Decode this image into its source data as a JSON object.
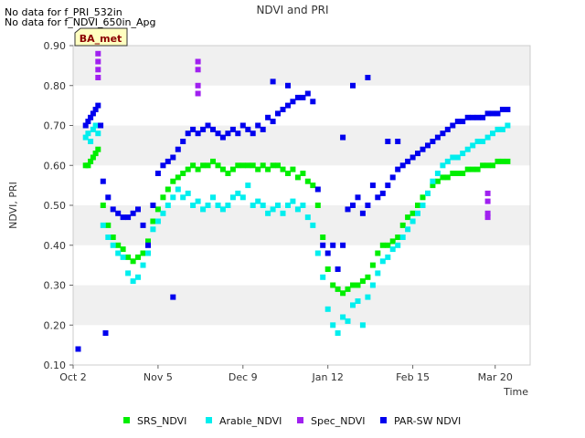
{
  "notes": [
    "No data for f_PRI_532in",
    "No data for f_NDVI_650in_Apg"
  ],
  "badge": "BA_met",
  "chart_data": {
    "type": "scatter",
    "title": "NDVI and PRI",
    "xlabel": "Time",
    "ylabel": "NDVI, PRI",
    "x_ticks": [
      "Oct 2",
      "Nov 5",
      "Dec 9",
      "Jan 12",
      "Feb 15",
      "Mar 20"
    ],
    "x_tick_day": [
      0,
      34,
      68,
      102,
      136,
      169
    ],
    "xlim": [
      0,
      183
    ],
    "ylim": [
      0.1,
      0.9
    ],
    "y_ticks": [
      0.1,
      0.2,
      0.3,
      0.4,
      0.5,
      0.6,
      0.7,
      0.8,
      0.9
    ],
    "grid": "horizontal bands",
    "legend_position": "bottom",
    "series": [
      {
        "name": "SRS_NDVI",
        "color": "#00ee00",
        "points": [
          [
            5,
            0.6
          ],
          [
            6,
            0.6
          ],
          [
            7,
            0.61
          ],
          [
            8,
            0.62
          ],
          [
            9,
            0.63
          ],
          [
            10,
            0.64
          ],
          [
            12,
            0.5
          ],
          [
            14,
            0.45
          ],
          [
            16,
            0.42
          ],
          [
            18,
            0.4
          ],
          [
            20,
            0.39
          ],
          [
            22,
            0.37
          ],
          [
            24,
            0.36
          ],
          [
            26,
            0.37
          ],
          [
            28,
            0.38
          ],
          [
            30,
            0.41
          ],
          [
            32,
            0.46
          ],
          [
            34,
            0.49
          ],
          [
            36,
            0.52
          ],
          [
            38,
            0.54
          ],
          [
            40,
            0.56
          ],
          [
            42,
            0.57
          ],
          [
            44,
            0.58
          ],
          [
            46,
            0.59
          ],
          [
            48,
            0.6
          ],
          [
            50,
            0.59
          ],
          [
            52,
            0.6
          ],
          [
            54,
            0.6
          ],
          [
            56,
            0.61
          ],
          [
            58,
            0.6
          ],
          [
            60,
            0.59
          ],
          [
            62,
            0.58
          ],
          [
            64,
            0.59
          ],
          [
            66,
            0.6
          ],
          [
            68,
            0.6
          ],
          [
            70,
            0.6
          ],
          [
            72,
            0.6
          ],
          [
            74,
            0.59
          ],
          [
            76,
            0.6
          ],
          [
            78,
            0.59
          ],
          [
            80,
            0.6
          ],
          [
            82,
            0.6
          ],
          [
            84,
            0.59
          ],
          [
            86,
            0.58
          ],
          [
            88,
            0.59
          ],
          [
            90,
            0.57
          ],
          [
            92,
            0.58
          ],
          [
            94,
            0.56
          ],
          [
            96,
            0.55
          ],
          [
            98,
            0.5
          ],
          [
            100,
            0.42
          ],
          [
            102,
            0.34
          ],
          [
            104,
            0.3
          ],
          [
            106,
            0.29
          ],
          [
            108,
            0.28
          ],
          [
            110,
            0.29
          ],
          [
            112,
            0.3
          ],
          [
            114,
            0.3
          ],
          [
            116,
            0.31
          ],
          [
            118,
            0.32
          ],
          [
            120,
            0.35
          ],
          [
            122,
            0.38
          ],
          [
            124,
            0.4
          ],
          [
            126,
            0.4
          ],
          [
            128,
            0.41
          ],
          [
            130,
            0.42
          ],
          [
            132,
            0.45
          ],
          [
            134,
            0.47
          ],
          [
            136,
            0.48
          ],
          [
            138,
            0.5
          ],
          [
            140,
            0.52
          ],
          [
            142,
            0.53
          ],
          [
            144,
            0.55
          ],
          [
            146,
            0.56
          ],
          [
            148,
            0.57
          ],
          [
            150,
            0.57
          ],
          [
            152,
            0.58
          ],
          [
            154,
            0.58
          ],
          [
            156,
            0.58
          ],
          [
            158,
            0.59
          ],
          [
            160,
            0.59
          ],
          [
            162,
            0.59
          ],
          [
            164,
            0.6
          ],
          [
            166,
            0.6
          ],
          [
            168,
            0.6
          ],
          [
            170,
            0.61
          ],
          [
            172,
            0.61
          ],
          [
            174,
            0.61
          ]
        ]
      },
      {
        "name": "Arable_NDVI",
        "color": "#00eeee",
        "points": [
          [
            5,
            0.67
          ],
          [
            6,
            0.68
          ],
          [
            7,
            0.66
          ],
          [
            8,
            0.69
          ],
          [
            9,
            0.7
          ],
          [
            10,
            0.68
          ],
          [
            12,
            0.45
          ],
          [
            14,
            0.42
          ],
          [
            16,
            0.4
          ],
          [
            18,
            0.38
          ],
          [
            20,
            0.37
          ],
          [
            22,
            0.33
          ],
          [
            24,
            0.31
          ],
          [
            26,
            0.32
          ],
          [
            28,
            0.35
          ],
          [
            30,
            0.38
          ],
          [
            32,
            0.44
          ],
          [
            34,
            0.46
          ],
          [
            36,
            0.48
          ],
          [
            38,
            0.5
          ],
          [
            40,
            0.52
          ],
          [
            42,
            0.54
          ],
          [
            44,
            0.52
          ],
          [
            46,
            0.53
          ],
          [
            48,
            0.5
          ],
          [
            50,
            0.51
          ],
          [
            52,
            0.49
          ],
          [
            54,
            0.5
          ],
          [
            56,
            0.52
          ],
          [
            58,
            0.5
          ],
          [
            60,
            0.49
          ],
          [
            62,
            0.5
          ],
          [
            64,
            0.52
          ],
          [
            66,
            0.53
          ],
          [
            68,
            0.52
          ],
          [
            70,
            0.55
          ],
          [
            72,
            0.5
          ],
          [
            74,
            0.51
          ],
          [
            76,
            0.5
          ],
          [
            78,
            0.48
          ],
          [
            80,
            0.49
          ],
          [
            82,
            0.5
          ],
          [
            84,
            0.48
          ],
          [
            86,
            0.5
          ],
          [
            88,
            0.51
          ],
          [
            90,
            0.49
          ],
          [
            92,
            0.5
          ],
          [
            94,
            0.47
          ],
          [
            96,
            0.45
          ],
          [
            98,
            0.38
          ],
          [
            100,
            0.32
          ],
          [
            102,
            0.24
          ],
          [
            104,
            0.2
          ],
          [
            106,
            0.18
          ],
          [
            108,
            0.22
          ],
          [
            110,
            0.21
          ],
          [
            112,
            0.25
          ],
          [
            114,
            0.26
          ],
          [
            116,
            0.2
          ],
          [
            118,
            0.27
          ],
          [
            120,
            0.3
          ],
          [
            122,
            0.33
          ],
          [
            124,
            0.36
          ],
          [
            126,
            0.37
          ],
          [
            128,
            0.39
          ],
          [
            130,
            0.4
          ],
          [
            132,
            0.42
          ],
          [
            134,
            0.44
          ],
          [
            136,
            0.46
          ],
          [
            138,
            0.48
          ],
          [
            140,
            0.5
          ],
          [
            142,
            0.53
          ],
          [
            144,
            0.56
          ],
          [
            146,
            0.58
          ],
          [
            148,
            0.6
          ],
          [
            150,
            0.61
          ],
          [
            152,
            0.62
          ],
          [
            154,
            0.62
          ],
          [
            156,
            0.63
          ],
          [
            158,
            0.64
          ],
          [
            160,
            0.65
          ],
          [
            162,
            0.66
          ],
          [
            164,
            0.66
          ],
          [
            166,
            0.67
          ],
          [
            168,
            0.68
          ],
          [
            170,
            0.69
          ],
          [
            172,
            0.69
          ],
          [
            174,
            0.7
          ]
        ]
      },
      {
        "name": "Spec_NDVI",
        "color": "#a020f0",
        "points": [
          [
            10,
            0.88
          ],
          [
            10,
            0.86
          ],
          [
            10,
            0.84
          ],
          [
            10,
            0.82
          ],
          [
            50,
            0.86
          ],
          [
            50,
            0.84
          ],
          [
            50,
            0.8
          ],
          [
            50,
            0.78
          ],
          [
            166,
            0.53
          ],
          [
            166,
            0.51
          ],
          [
            166,
            0.48
          ],
          [
            166,
            0.47
          ]
        ]
      },
      {
        "name": "PAR-SW NDVI",
        "color": "#0000ee",
        "points": [
          [
            5,
            0.7
          ],
          [
            6,
            0.71
          ],
          [
            7,
            0.72
          ],
          [
            8,
            0.73
          ],
          [
            9,
            0.74
          ],
          [
            10,
            0.75
          ],
          [
            11,
            0.7
          ],
          [
            12,
            0.56
          ],
          [
            14,
            0.52
          ],
          [
            16,
            0.49
          ],
          [
            18,
            0.48
          ],
          [
            20,
            0.47
          ],
          [
            22,
            0.47
          ],
          [
            24,
            0.48
          ],
          [
            26,
            0.49
          ],
          [
            28,
            0.45
          ],
          [
            30,
            0.4
          ],
          [
            32,
            0.5
          ],
          [
            34,
            0.58
          ],
          [
            36,
            0.6
          ],
          [
            38,
            0.61
          ],
          [
            40,
            0.62
          ],
          [
            42,
            0.64
          ],
          [
            44,
            0.66
          ],
          [
            46,
            0.68
          ],
          [
            48,
            0.69
          ],
          [
            50,
            0.68
          ],
          [
            52,
            0.69
          ],
          [
            54,
            0.7
          ],
          [
            56,
            0.69
          ],
          [
            58,
            0.68
          ],
          [
            60,
            0.67
          ],
          [
            62,
            0.68
          ],
          [
            64,
            0.69
          ],
          [
            66,
            0.68
          ],
          [
            68,
            0.7
          ],
          [
            70,
            0.69
          ],
          [
            72,
            0.68
          ],
          [
            74,
            0.7
          ],
          [
            76,
            0.69
          ],
          [
            78,
            0.72
          ],
          [
            80,
            0.71
          ],
          [
            82,
            0.73
          ],
          [
            84,
            0.74
          ],
          [
            86,
            0.75
          ],
          [
            88,
            0.76
          ],
          [
            90,
            0.77
          ],
          [
            92,
            0.77
          ],
          [
            94,
            0.78
          ],
          [
            96,
            0.76
          ],
          [
            98,
            0.54
          ],
          [
            100,
            0.4
          ],
          [
            102,
            0.38
          ],
          [
            104,
            0.4
          ],
          [
            106,
            0.34
          ],
          [
            108,
            0.4
          ],
          [
            110,
            0.49
          ],
          [
            112,
            0.5
          ],
          [
            114,
            0.52
          ],
          [
            116,
            0.48
          ],
          [
            118,
            0.5
          ],
          [
            120,
            0.55
          ],
          [
            122,
            0.52
          ],
          [
            124,
            0.53
          ],
          [
            126,
            0.55
          ],
          [
            128,
            0.57
          ],
          [
            130,
            0.59
          ],
          [
            132,
            0.6
          ],
          [
            134,
            0.61
          ],
          [
            136,
            0.62
          ],
          [
            138,
            0.63
          ],
          [
            140,
            0.64
          ],
          [
            142,
            0.65
          ],
          [
            144,
            0.66
          ],
          [
            146,
            0.67
          ],
          [
            148,
            0.68
          ],
          [
            150,
            0.69
          ],
          [
            152,
            0.7
          ],
          [
            154,
            0.71
          ],
          [
            156,
            0.71
          ],
          [
            158,
            0.72
          ],
          [
            160,
            0.72
          ],
          [
            162,
            0.72
          ],
          [
            164,
            0.72
          ],
          [
            166,
            0.73
          ],
          [
            168,
            0.73
          ],
          [
            170,
            0.73
          ],
          [
            172,
            0.74
          ],
          [
            174,
            0.74
          ],
          [
            2,
            0.14
          ],
          [
            13,
            0.18
          ],
          [
            40,
            0.27
          ],
          [
            80,
            0.81
          ],
          [
            86,
            0.8
          ],
          [
            112,
            0.8
          ],
          [
            118,
            0.82
          ],
          [
            108,
            0.67
          ],
          [
            126,
            0.66
          ],
          [
            130,
            0.66
          ]
        ]
      }
    ]
  }
}
